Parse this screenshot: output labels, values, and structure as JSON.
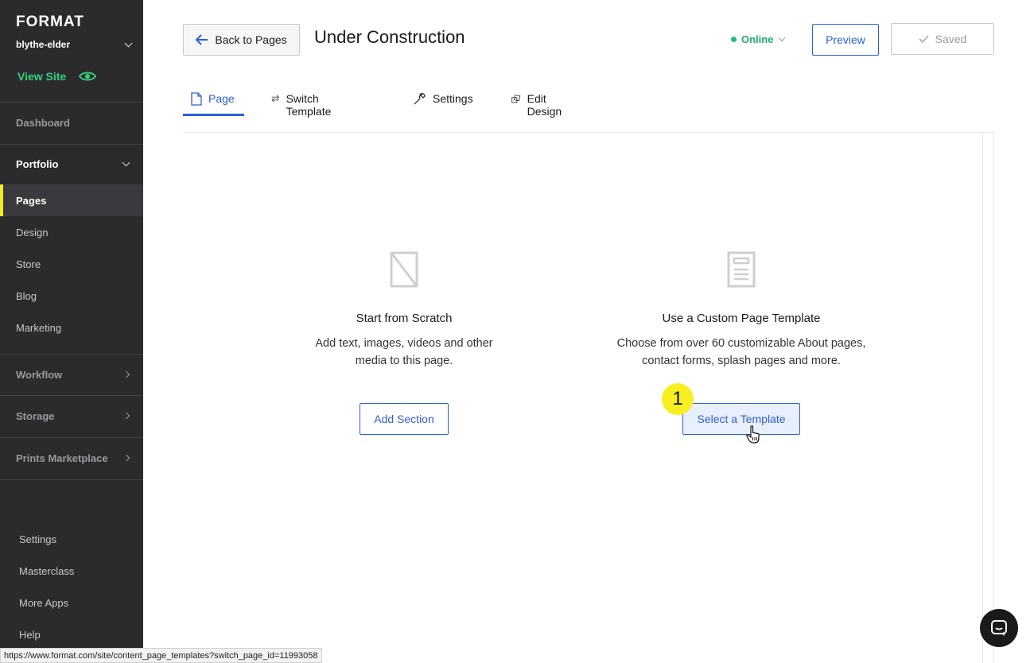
{
  "sidebar": {
    "logo": "FORMAT",
    "site_name": "blythe-elder",
    "view_site": "View Site",
    "dashboard": "Dashboard",
    "portfolio": "Portfolio",
    "portfolio_items": [
      "Pages",
      "Design",
      "Store",
      "Blog",
      "Marketing"
    ],
    "active_item": "Pages",
    "workflow": "Workflow",
    "storage": "Storage",
    "prints_marketplace": "Prints Marketplace",
    "bottom_items": [
      "Settings",
      "Masterclass",
      "More Apps",
      "Help"
    ],
    "accent_color": "#35d07f",
    "active_marker_color": "#f5e92a"
  },
  "header": {
    "back_label": "Back to Pages",
    "title": "Under Construction",
    "status": "Online",
    "preview_label": "Preview",
    "saved_label": "Saved"
  },
  "tabs": [
    {
      "label": "Page",
      "icon": "page-icon",
      "active": true
    },
    {
      "label": "Switch Template",
      "icon": "switch-arrows-icon",
      "active": false
    },
    {
      "label": "Settings",
      "icon": "wrench-icon",
      "active": false
    },
    {
      "label": "Edit Design",
      "icon": "design-icon",
      "active": false
    }
  ],
  "options": {
    "scratch": {
      "title": "Start from Scratch",
      "description": "Add text, images, videos and other media to this page.",
      "button": "Add Section"
    },
    "template": {
      "title": "Use a Custom Page Template",
      "description": "Choose from over 60 customizable About pages, contact forms, splash pages and more.",
      "button": "Select a Template"
    }
  },
  "annotation": {
    "step_number": "1"
  },
  "status_url": "https://www.format.com/site/content_page_templates?switch_page_id=11993058",
  "colors": {
    "primary_blue": "#2c5fd6",
    "online_green": "#1fae6a",
    "badge_yellow": "#f7ef22"
  }
}
